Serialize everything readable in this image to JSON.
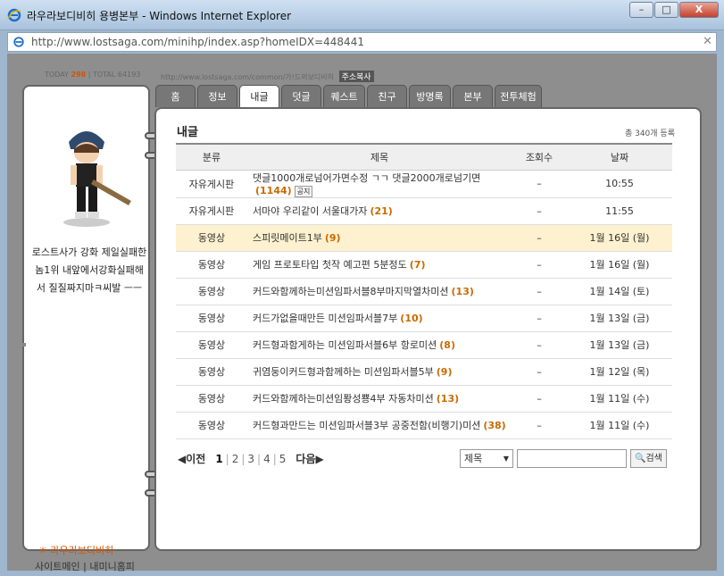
{
  "window": {
    "title": "라우라보디비히 용병본부 - Windows Internet Explorer",
    "minimize": "–",
    "maximize": "□",
    "close": "X"
  },
  "address": {
    "url": "http://www.lostsaga.com/minihp/index.asp?homeIDX=448441"
  },
  "stats": {
    "today_label": "TODAY",
    "today": "298",
    "total_label": "TOTAL",
    "total": "64193",
    "home_url": "http://www.lostsaga.com/common/가!드외보디비히",
    "copy_label": "주소복사"
  },
  "profile": {
    "text": "로스트사가 강화 제일실패한놈1위 내앞에서강화실패해서 질질짜지마ㅋ씨발 ㅡㅡ",
    "nickname": "라우라보디비히",
    "site_main": "사이트메인",
    "my_minihome": "내미니홈피",
    "link_sep": "|"
  },
  "tabs": [
    "홈",
    "정보",
    "내글",
    "덧글",
    "퀘스트",
    "친구",
    "방명록",
    "본부",
    "전투체험"
  ],
  "active_tab": 2,
  "board": {
    "title": "내글",
    "count": "총 340개 등록",
    "columns": {
      "category": "분류",
      "title": "제목",
      "views": "조회수",
      "date": "날짜"
    },
    "notice_label": "공지",
    "rows": [
      {
        "category": "자유게시판",
        "title": "댓글1000개로넘어가면수정 ㄱㄱ 댓글2000개로넘기면",
        "comments": "(1144)",
        "views": "–",
        "date": "10:55"
      },
      {
        "category": "자유게시판",
        "title": "서마야 우리같이 서울대가자",
        "comments": "(21)",
        "views": "–",
        "date": "11:55"
      },
      {
        "category": "동영상",
        "title": "스피릿메이트1부",
        "comments": "(9)",
        "views": "–",
        "date": "1월 16일 (월)"
      },
      {
        "category": "동영상",
        "title": "게임 프로토타입 첫작 예고편 5분정도",
        "comments": "(7)",
        "views": "–",
        "date": "1월 16일 (월)"
      },
      {
        "category": "동영상",
        "title": "커드와함께하는미션임파서블8부마지막열차미션",
        "comments": "(13)",
        "views": "–",
        "date": "1월 14일 (토)"
      },
      {
        "category": "동영상",
        "title": "커드가없을때만든 미션임파서블7부",
        "comments": "(10)",
        "views": "–",
        "date": "1월 13일 (금)"
      },
      {
        "category": "동영상",
        "title": "커드형과함게하는 미션임파서블6부 항로미션",
        "comments": "(8)",
        "views": "–",
        "date": "1월 13일 (금)"
      },
      {
        "category": "동영상",
        "title": "귀염둥이커드형과함께하는 미션임파서블5부",
        "comments": "(9)",
        "views": "–",
        "date": "1월 12일 (목)"
      },
      {
        "category": "동영상",
        "title": "커드와함께하는미션임퐝성뿅4부 자동차미션",
        "comments": "(13)",
        "views": "–",
        "date": "1월 11일 (수)"
      },
      {
        "category": "동영상",
        "title": "커드형과만드는 미션임파서블3부 공중전함(비행기)미션",
        "comments": "(38)",
        "views": "–",
        "date": "1월 11일 (수)"
      }
    ]
  },
  "pager": {
    "prev": "◀이전",
    "pages": [
      "1",
      "2",
      "3",
      "4",
      "5"
    ],
    "current": "1",
    "next": "다음▶",
    "sep": "|"
  },
  "search": {
    "select_value": "제목",
    "arrow": "▼",
    "button": "검색"
  },
  "colors": {
    "accent": "#d35400",
    "highlight_row": "#fdf1cf",
    "tab": "#777777",
    "frame": "#8e8e8e"
  }
}
